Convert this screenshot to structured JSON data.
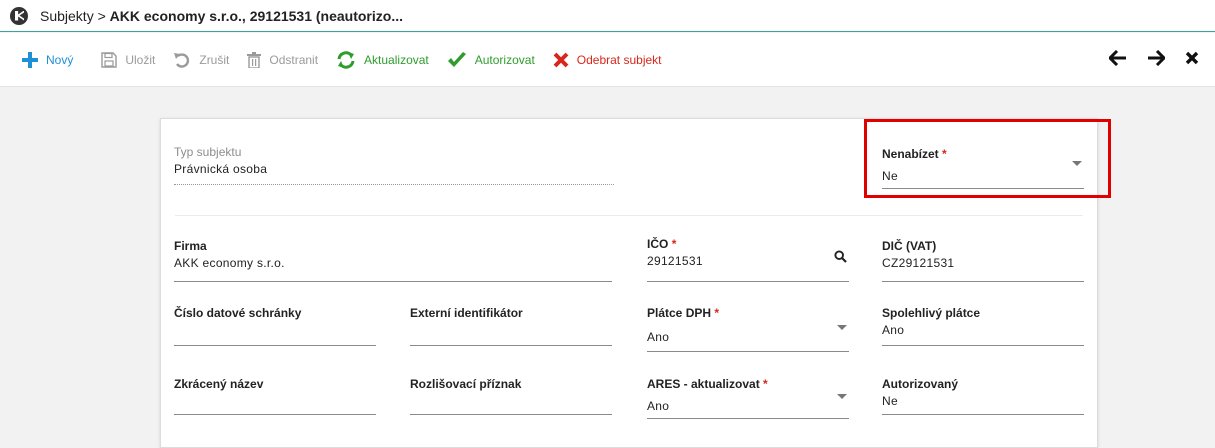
{
  "titlebar": {
    "crumb_root": "Subjekty",
    "crumb_sep": ">",
    "crumb_current": "AKK economy s.r.o., 29121531 (neautorizo..."
  },
  "toolbar": {
    "new_label": "Nový",
    "save_label": "Uložit",
    "cancel_label": "Zrušit",
    "delete_label": "Odstranit",
    "refresh_label": "Aktualizovat",
    "authorize_label": "Autorizovat",
    "remove_label": "Odebrat subjekt"
  },
  "form": {
    "typ_subjektu": {
      "label": "Typ subjektu",
      "value": "Právnická osoba"
    },
    "nenabizet": {
      "label": "Nenabízet",
      "value": "Ne",
      "required": "*"
    },
    "firma": {
      "label": "Firma",
      "value": "AKK economy s.r.o."
    },
    "ico": {
      "label": "IČO",
      "value": "29121531",
      "required": "*"
    },
    "dic": {
      "label": "DIČ (VAT)",
      "value": "CZ29121531"
    },
    "datova_schranka": {
      "label": "Číslo datové schránky",
      "value": ""
    },
    "externi_id": {
      "label": "Externí identifikátor",
      "value": ""
    },
    "platce_dph": {
      "label": "Plátce DPH",
      "value": "Ano",
      "required": "*"
    },
    "spolehlivy": {
      "label": "Spolehlivý plátce",
      "value": "Ano"
    },
    "zkraceny_nazev": {
      "label": "Zkrácený název",
      "value": ""
    },
    "rozlisovaci": {
      "label": "Rozlišovací příznak",
      "value": ""
    },
    "ares": {
      "label": "ARES - aktualizovat",
      "value": "Ano",
      "required": "*"
    },
    "autorizovany": {
      "label": "Autorizovaný",
      "value": "Ne"
    }
  },
  "colors": {
    "accent_blue": "#1f8fd6",
    "green": "#2e9d2e",
    "red": "#d9261c",
    "highlight": "#e10000"
  }
}
